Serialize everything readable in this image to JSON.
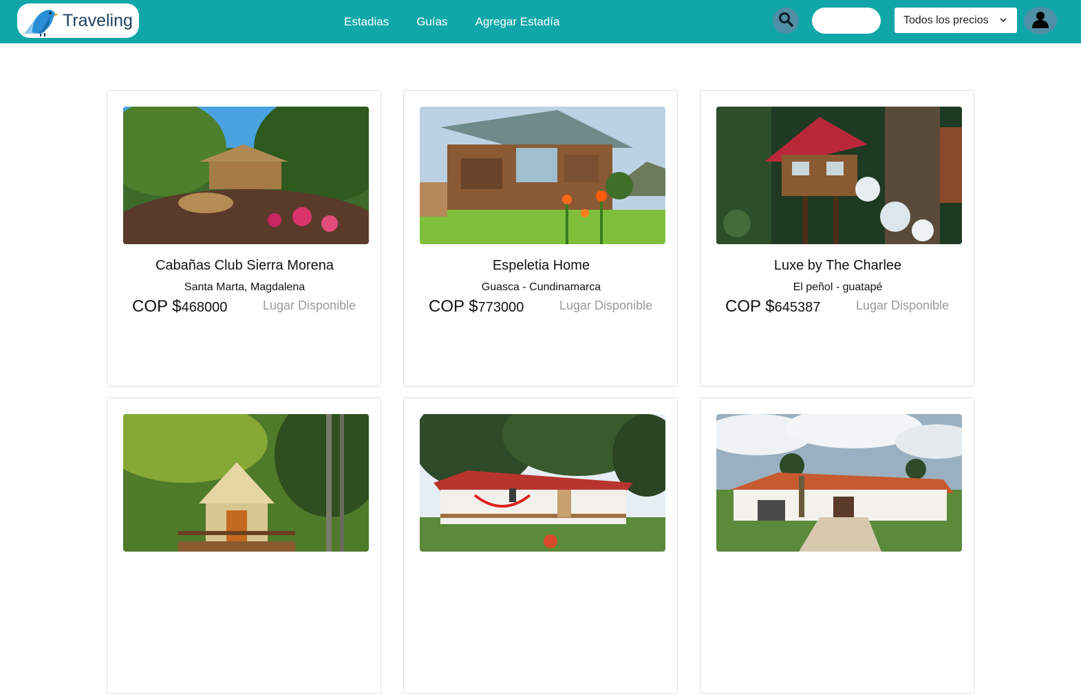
{
  "brand": {
    "name": "Traveling"
  },
  "nav": {
    "links": [
      "Estadias",
      "Guías",
      "Agregar Estadía"
    ]
  },
  "search": {
    "placeholder": "",
    "value": ""
  },
  "price_filter": {
    "selected": "Todos los precios"
  },
  "currency_prefix": "COP $",
  "stays": [
    {
      "title": "Cabañas Club Sierra Morena",
      "location": "Santa Marta, Magdalena",
      "price": "468000",
      "status": "Lugar Disponible"
    },
    {
      "title": "Espeletia Home",
      "location": "Guasca - Cundinamarca",
      "price": "773000",
      "status": "Lugar Disponible"
    },
    {
      "title": "Luxe by The Charlee",
      "location": "El peñol - guatapé",
      "price": "645387",
      "status": "Lugar Disponible"
    },
    {
      "title": "",
      "location": "",
      "price": "",
      "status": ""
    },
    {
      "title": "",
      "location": "",
      "price": "",
      "status": ""
    },
    {
      "title": "",
      "location": "",
      "price": "",
      "status": ""
    }
  ],
  "colors": {
    "navbar": "#11a7a9",
    "brand_text": "#1d3f5f",
    "availability": "#999999"
  },
  "icons": {
    "logo": "bird-logo-icon",
    "search": "search-icon",
    "dropdown": "chevron-down-icon",
    "user": "user-icon"
  }
}
